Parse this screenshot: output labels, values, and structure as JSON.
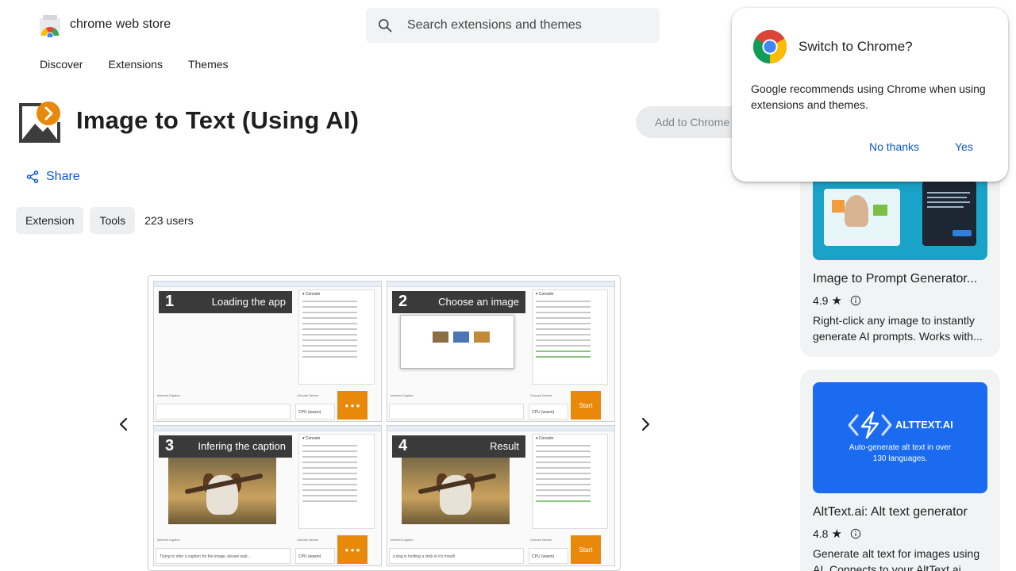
{
  "header": {
    "store_name": "chrome web store",
    "search_placeholder": "Search extensions and themes"
  },
  "nav": [
    "Discover",
    "Extensions",
    "Themes"
  ],
  "extension": {
    "title": "Image to Text (Using AI)",
    "add_button": "Add to Chrome",
    "share_label": "Share",
    "chips": [
      "Extension",
      "Tools"
    ],
    "users": "223 users"
  },
  "screenshot": {
    "panes": [
      {
        "num": "1",
        "caption": "Loading the app",
        "caption_text": "",
        "device": "CPU (wasm)",
        "action": "● ● ●"
      },
      {
        "num": "2",
        "caption": "Choose an image",
        "caption_text": "",
        "device": "CPU (wasm)",
        "action": "Start"
      },
      {
        "num": "3",
        "caption": "Infering the caption",
        "caption_text": "Trying to infer a caption for the image, please wait...",
        "device": "CPU (wasm)",
        "action": "● ● ●"
      },
      {
        "num": "4",
        "caption": "Result",
        "caption_text": "a dog is holding a stick in it's mouth",
        "device": "CPU (wasm)",
        "action": "Start"
      }
    ],
    "console_label": "▾ Console",
    "inferred_caption_label": "Inferred Caption",
    "choose_device_label": "Choose Device"
  },
  "sidebar": {
    "cards": [
      {
        "name": "Image to Prompt Generator...",
        "rating": "4.9",
        "description": "Right-click any image to instantly generate AI prompts. Works with..."
      },
      {
        "name": "AltText.ai: Alt text generator",
        "rating": "4.8",
        "description": "Generate alt text for images using AI. Connects to your AltText.ai",
        "banner_brand": "ALTTEXT.AI",
        "banner_text": "Auto-generate alt text in over 130 languages."
      }
    ]
  },
  "popup": {
    "title": "Switch to Chrome?",
    "body": "Google recommends using Chrome when using extensions and themes.",
    "no_button": "No thanks",
    "yes_button": "Yes"
  },
  "colors": {
    "accent_blue": "#0b57d0",
    "orange": "#e8890c",
    "altext_blue": "#1a6bf0"
  }
}
